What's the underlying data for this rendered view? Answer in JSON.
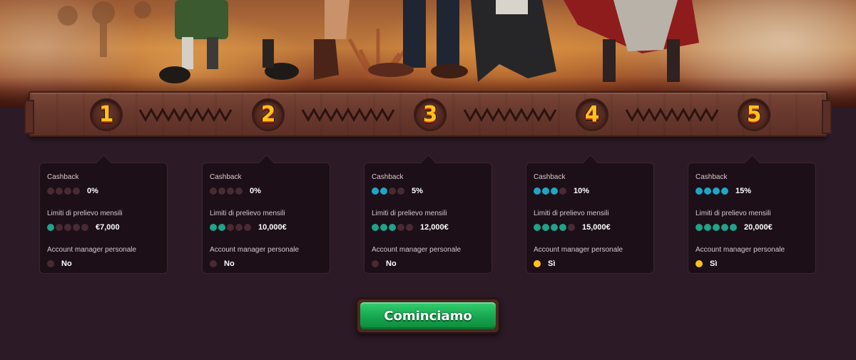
{
  "colors": {
    "accent_yellow": "#ffc21a",
    "dot_blue": "#1fa6c4",
    "dot_green": "#1fa38a",
    "dot_off": "#4a2a32",
    "cta_green": "#16a54e",
    "background": "#2c1a26",
    "card_bg": "#1c0f17"
  },
  "hero": {
    "image_name": "western-characters-banner"
  },
  "levels": [
    "1",
    "2",
    "3",
    "4",
    "5"
  ],
  "tiers": [
    {
      "cashback_label": "Cashback",
      "cashback_value": "0%",
      "cashback_level": 0,
      "withdraw_label": "Limiti di prelievo mensili",
      "withdraw_value": "€7,000",
      "withdraw_level": 1,
      "manager_label": "Account manager personale",
      "manager_value": "No",
      "manager_enabled": false
    },
    {
      "cashback_label": "Cashback",
      "cashback_value": "0%",
      "cashback_level": 0,
      "withdraw_label": "Limiti di prelievo mensili",
      "withdraw_value": "10,000€",
      "withdraw_level": 2,
      "manager_label": "Account manager personale",
      "manager_value": "No",
      "manager_enabled": false
    },
    {
      "cashback_label": "Cashback",
      "cashback_value": "5%",
      "cashback_level": 2,
      "withdraw_label": "Limiti di prelievo mensili",
      "withdraw_value": "12,000€",
      "withdraw_level": 3,
      "manager_label": "Account manager personale",
      "manager_value": "No",
      "manager_enabled": false
    },
    {
      "cashback_label": "Cashback",
      "cashback_value": "10%",
      "cashback_level": 3,
      "withdraw_label": "Limiti di prelievo mensili",
      "withdraw_value": "15,000€",
      "withdraw_level": 4,
      "manager_label": "Account manager personale",
      "manager_value": "Sì",
      "manager_enabled": true
    },
    {
      "cashback_label": "Cashback",
      "cashback_value": "15%",
      "cashback_level": 4,
      "withdraw_label": "Limiti di prelievo mensili",
      "withdraw_value": "20,000€",
      "withdraw_level": 5,
      "manager_label": "Account manager personale",
      "manager_value": "Sì",
      "manager_enabled": true
    }
  ],
  "cta": {
    "label": "Cominciamo"
  }
}
